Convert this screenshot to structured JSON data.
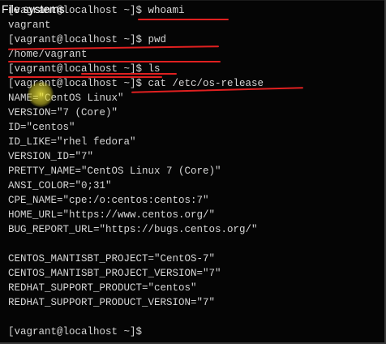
{
  "window": {
    "title": "File systems"
  },
  "terminal": {
    "lines": [
      "[vagrant@localhost ~]$ whoami",
      "vagrant",
      "[vagrant@localhost ~]$ pwd",
      "/home/vagrant",
      "[vagrant@localhost ~]$ ls",
      "[vagrant@localhost ~]$ cat /etc/os-release",
      "NAME=\"CentOS Linux\"",
      "VERSION=\"7 (Core)\"",
      "ID=\"centos\"",
      "ID_LIKE=\"rhel fedora\"",
      "VERSION_ID=\"7\"",
      "PRETTY_NAME=\"CentOS Linux 7 (Core)\"",
      "ANSI_COLOR=\"0;31\"",
      "CPE_NAME=\"cpe:/o:centos:centos:7\"",
      "HOME_URL=\"https://www.centos.org/\"",
      "BUG_REPORT_URL=\"https://bugs.centos.org/\"",
      "",
      "CENTOS_MANTISBT_PROJECT=\"CentOS-7\"",
      "CENTOS_MANTISBT_PROJECT_VERSION=\"7\"",
      "REDHAT_SUPPORT_PRODUCT=\"centos\"",
      "REDHAT_SUPPORT_PRODUCT_VERSION=\"7\"",
      "",
      "[vagrant@localhost ~]$"
    ]
  },
  "colors": {
    "background": "#050505",
    "text": "#d6d6d6",
    "annotation": "#e02020",
    "cursor_highlight": "#eee63c"
  },
  "annotations": {
    "underline_count": 6,
    "cursor_highlight_icon": "yellow-cursor-circle"
  }
}
